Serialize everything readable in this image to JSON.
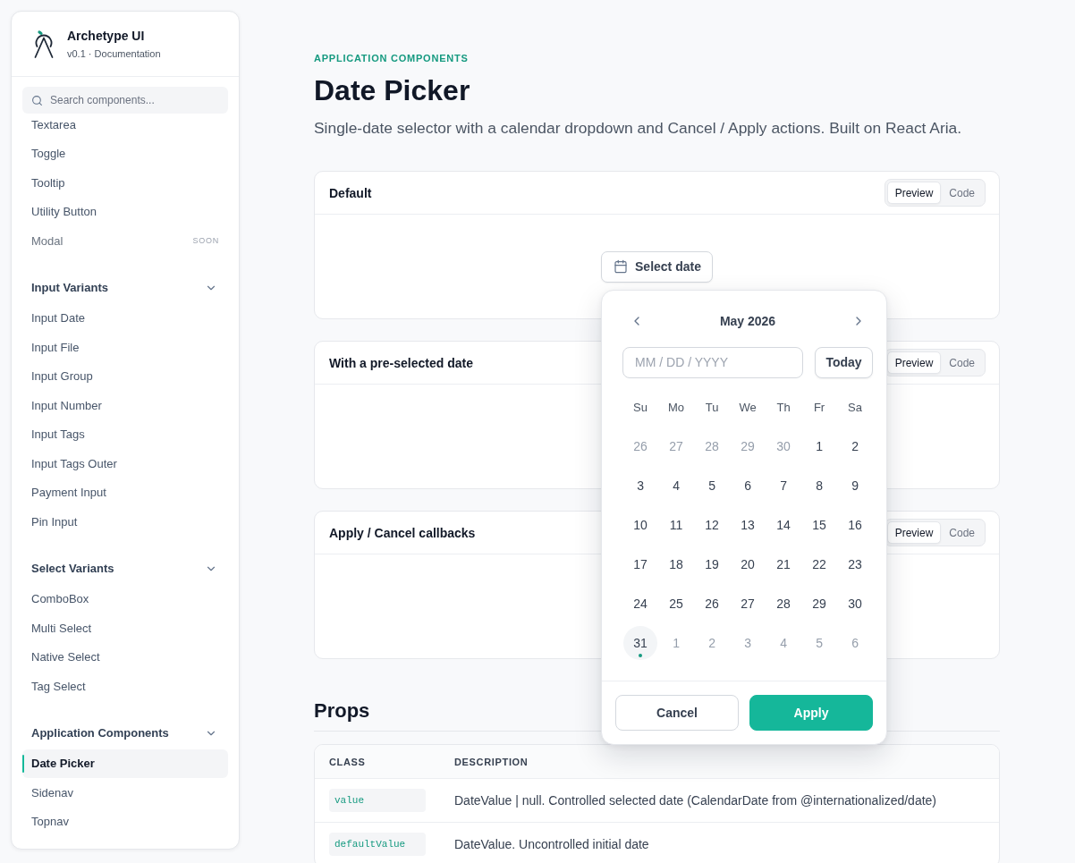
{
  "sidebar": {
    "brand": {
      "title": "Archetype UI",
      "subtitle": "v0.1 · Documentation"
    },
    "search": {
      "placeholder": "Search components..."
    },
    "groups": [
      {
        "items": [
          {
            "label": "Textarea",
            "selected": false,
            "disabled": false
          },
          {
            "label": "Toggle",
            "selected": false,
            "disabled": false
          },
          {
            "label": "Tooltip",
            "selected": false,
            "disabled": false
          },
          {
            "label": "Utility Button",
            "selected": false,
            "disabled": false
          },
          {
            "label": "Modal",
            "selected": false,
            "disabled": true,
            "badge": "SOON"
          }
        ]
      },
      {
        "title": "Input Variants",
        "expanded": true,
        "items": [
          {
            "label": "Input Date",
            "selected": false,
            "disabled": false
          },
          {
            "label": "Input File",
            "selected": false,
            "disabled": false
          },
          {
            "label": "Input Group",
            "selected": false,
            "disabled": false
          },
          {
            "label": "Input Number",
            "selected": false,
            "disabled": false
          },
          {
            "label": "Input Tags",
            "selected": false,
            "disabled": false
          },
          {
            "label": "Input Tags Outer",
            "selected": false,
            "disabled": false
          },
          {
            "label": "Payment Input",
            "selected": false,
            "disabled": false
          },
          {
            "label": "Pin Input",
            "selected": false,
            "disabled": false
          }
        ]
      },
      {
        "title": "Select Variants",
        "expanded": true,
        "items": [
          {
            "label": "ComboBox",
            "selected": false,
            "disabled": false
          },
          {
            "label": "Multi Select",
            "selected": false,
            "disabled": false
          },
          {
            "label": "Native Select",
            "selected": false,
            "disabled": false
          },
          {
            "label": "Tag Select",
            "selected": false,
            "disabled": false
          }
        ]
      },
      {
        "title": "Application Components",
        "expanded": true,
        "items": [
          {
            "label": "Date Picker",
            "selected": true,
            "disabled": false
          },
          {
            "label": "Sidenav",
            "selected": false,
            "disabled": false
          },
          {
            "label": "Topnav",
            "selected": false,
            "disabled": false
          }
        ]
      }
    ]
  },
  "page": {
    "eyebrow": "APPLICATION COMPONENTS",
    "title": "Date Picker",
    "description": "Single-date selector with a calendar dropdown and Cancel / Apply actions. Built on React Aria."
  },
  "examples": [
    {
      "title": "Default",
      "tabs": [
        {
          "label": "Preview",
          "selected": true
        },
        {
          "label": "Code",
          "selected": false
        }
      ],
      "trigger": {
        "label": "Select date"
      }
    },
    {
      "title": "With a pre-selected date",
      "tabs": [
        {
          "label": "Preview",
          "selected": true
        },
        {
          "label": "Code",
          "selected": false
        }
      ]
    },
    {
      "title": "Apply / Cancel callbacks",
      "tabs": [
        {
          "label": "Preview",
          "selected": true
        },
        {
          "label": "Code",
          "selected": false
        }
      ]
    }
  ],
  "date_picker_popover": {
    "month": "May 2026",
    "input": {
      "placeholder": "MM / DD / YYYY"
    },
    "today_button": "Today",
    "weekdays": [
      "Su",
      "Mo",
      "Tu",
      "We",
      "Th",
      "Fr",
      "Sa"
    ],
    "weeks": [
      [
        {
          "day": "26",
          "outside": true,
          "today": false
        },
        {
          "day": "27",
          "outside": true,
          "today": false
        },
        {
          "day": "28",
          "outside": true,
          "today": false
        },
        {
          "day": "29",
          "outside": true,
          "today": false
        },
        {
          "day": "30",
          "outside": true,
          "today": false
        },
        {
          "day": "1",
          "outside": false,
          "today": false
        },
        {
          "day": "2",
          "outside": false,
          "today": false
        }
      ],
      [
        {
          "day": "3",
          "outside": false,
          "today": false
        },
        {
          "day": "4",
          "outside": false,
          "today": false
        },
        {
          "day": "5",
          "outside": false,
          "today": false
        },
        {
          "day": "6",
          "outside": false,
          "today": false
        },
        {
          "day": "7",
          "outside": false,
          "today": false
        },
        {
          "day": "8",
          "outside": false,
          "today": false
        },
        {
          "day": "9",
          "outside": false,
          "today": false
        }
      ],
      [
        {
          "day": "10",
          "outside": false,
          "today": false
        },
        {
          "day": "11",
          "outside": false,
          "today": false
        },
        {
          "day": "12",
          "outside": false,
          "today": false
        },
        {
          "day": "13",
          "outside": false,
          "today": false
        },
        {
          "day": "14",
          "outside": false,
          "today": false
        },
        {
          "day": "15",
          "outside": false,
          "today": false
        },
        {
          "day": "16",
          "outside": false,
          "today": false
        }
      ],
      [
        {
          "day": "17",
          "outside": false,
          "today": false
        },
        {
          "day": "18",
          "outside": false,
          "today": false
        },
        {
          "day": "19",
          "outside": false,
          "today": false
        },
        {
          "day": "20",
          "outside": false,
          "today": false
        },
        {
          "day": "21",
          "outside": false,
          "today": false
        },
        {
          "day": "22",
          "outside": false,
          "today": false
        },
        {
          "day": "23",
          "outside": false,
          "today": false
        }
      ],
      [
        {
          "day": "24",
          "outside": false,
          "today": false
        },
        {
          "day": "25",
          "outside": false,
          "today": false
        },
        {
          "day": "26",
          "outside": false,
          "today": false
        },
        {
          "day": "27",
          "outside": false,
          "today": false
        },
        {
          "day": "28",
          "outside": false,
          "today": false
        },
        {
          "day": "29",
          "outside": false,
          "today": false
        },
        {
          "day": "30",
          "outside": false,
          "today": false
        }
      ],
      [
        {
          "day": "31",
          "outside": false,
          "today": true
        },
        {
          "day": "1",
          "outside": true,
          "today": false
        },
        {
          "day": "2",
          "outside": true,
          "today": false
        },
        {
          "day": "3",
          "outside": true,
          "today": false
        },
        {
          "day": "4",
          "outside": true,
          "today": false
        },
        {
          "day": "5",
          "outside": true,
          "today": false
        },
        {
          "day": "6",
          "outside": true,
          "today": false
        }
      ]
    ],
    "actions": [
      {
        "label": "Cancel",
        "kind": "secondary"
      },
      {
        "label": "Apply",
        "kind": "primary"
      }
    ]
  },
  "props": {
    "title": "Props",
    "columns": [
      "CLASS",
      "DESCRIPTION"
    ],
    "rows": [
      {
        "name": "value",
        "description": "DateValue | null. Controlled selected date (CalendarDate from @internationalized/date)"
      },
      {
        "name": "defaultValue",
        "description": "DateValue. Uncontrolled initial date"
      }
    ]
  }
}
